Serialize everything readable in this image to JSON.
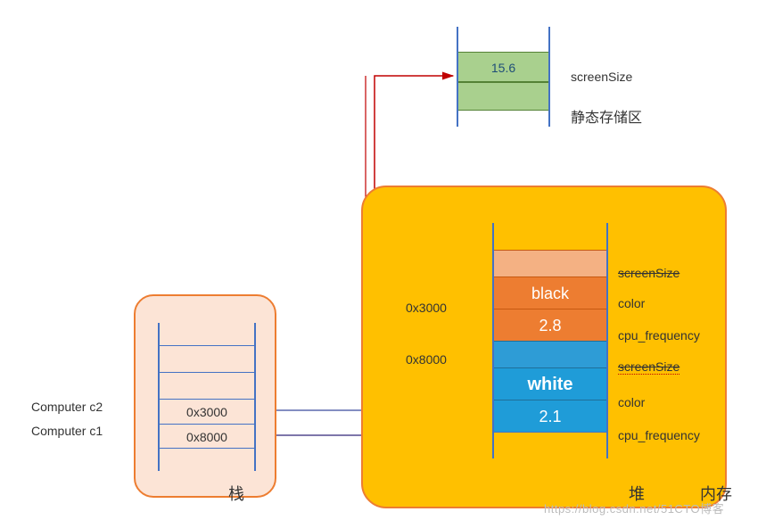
{
  "static": {
    "value": "15.6",
    "fieldLabel": "screenSize",
    "areaLabel": "静态存储区"
  },
  "stack": {
    "label": "栈",
    "c1Label": "Computer c1",
    "c2Label": "Computer c2",
    "c1Value": "0x8000",
    "c2Value": "0x3000"
  },
  "heap": {
    "label": "堆",
    "memoryLabel": "内存",
    "addr1": "0x3000",
    "addr2": "0x8000",
    "obj1": {
      "screenSizeLabel": "screenSize",
      "color": "black",
      "colorLabel": "color",
      "cpuFreq": "2.8",
      "cpuFreqLabel": "cpu_frequency"
    },
    "obj2": {
      "screenSizeLabel": "screenSize",
      "color": "white",
      "colorLabel": "color",
      "cpuFreq": "2.1",
      "cpuFreqLabel": "cpu_frequency"
    }
  },
  "watermark": "https://blog.csdn.net/51CTO博客",
  "chart_data": {
    "type": "diagram",
    "description": "Java/JVM-style memory layout diagram showing stack, heap and static storage.",
    "static_storage": [
      {
        "field": "screenSize",
        "value": 15.6
      }
    ],
    "stack_frames": [
      {
        "variable": "Computer c2",
        "address": "0x3000"
      },
      {
        "variable": "Computer c1",
        "address": "0x8000"
      }
    ],
    "heap_objects": [
      {
        "address": "0x3000",
        "fields": [
          {
            "name": "screenSize",
            "value": null,
            "note": "moved to static storage"
          },
          {
            "name": "color",
            "value": "black"
          },
          {
            "name": "cpu_frequency",
            "value": 2.8
          }
        ]
      },
      {
        "address": "0x8000",
        "fields": [
          {
            "name": "screenSize",
            "value": null,
            "note": "moved to static storage"
          },
          {
            "name": "color",
            "value": "white"
          },
          {
            "name": "cpu_frequency",
            "value": 2.1
          }
        ]
      }
    ],
    "pointers": [
      {
        "from": "stack:c2(0x3000)",
        "to": "heap:0x3000"
      },
      {
        "from": "stack:c1(0x8000)",
        "to": "heap:0x8000"
      },
      {
        "from": "heap:screenSize (both objects)",
        "to": "static:screenSize=15.6",
        "arrowColor": "red"
      }
    ]
  }
}
